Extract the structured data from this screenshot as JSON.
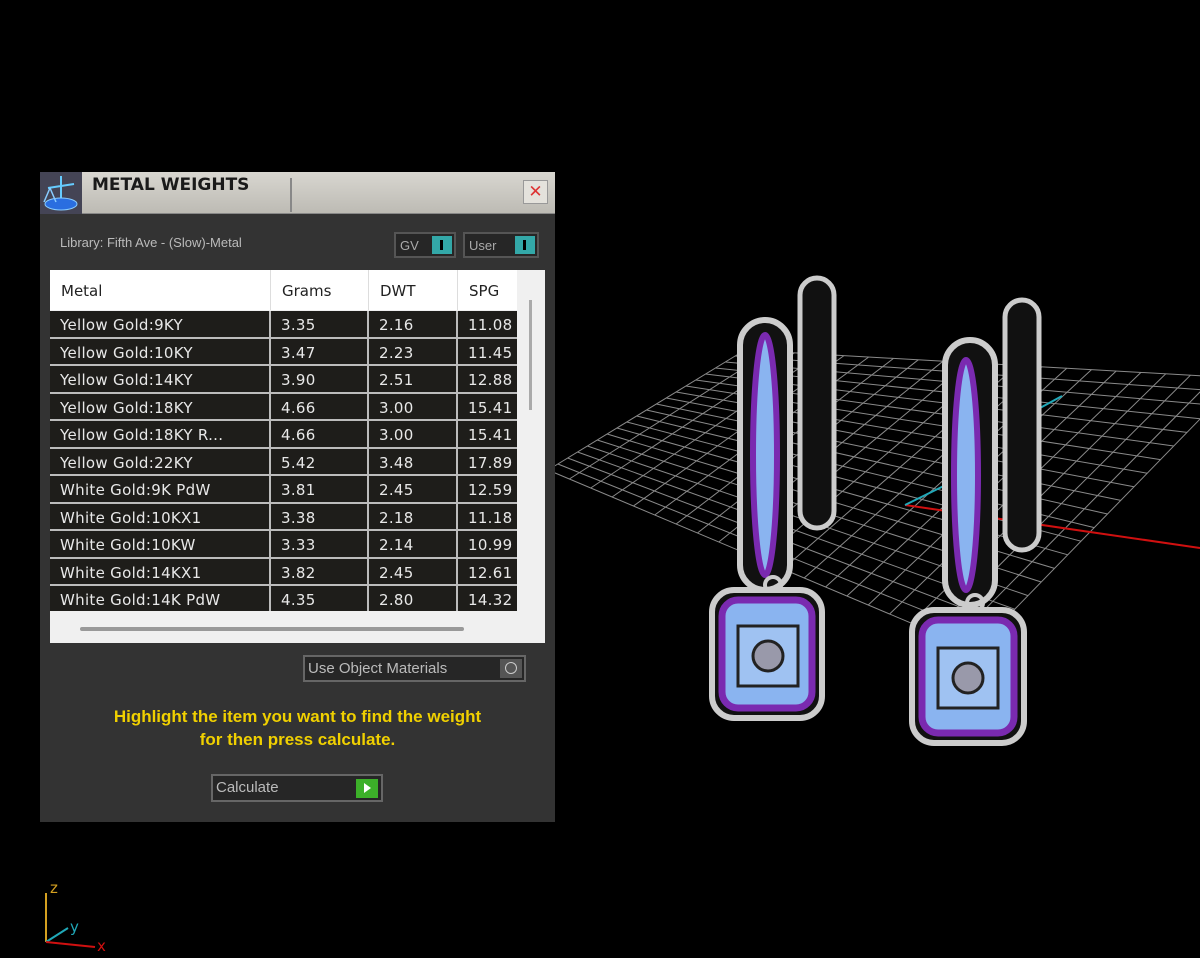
{
  "window": {
    "title": "METAL WEIGHTS",
    "close_icon": "close-icon",
    "app_icon": "scale-icon"
  },
  "library": {
    "label": "Library: Fifth Ave - (Slow)-Metal"
  },
  "toggles": {
    "gv": "GV",
    "user": "User"
  },
  "table": {
    "columns": [
      "Metal",
      "Grams",
      "DWT",
      "SPG"
    ],
    "rows": [
      [
        "Yellow Gold:9KY",
        "3.35",
        "2.16",
        "11.08"
      ],
      [
        "Yellow Gold:10KY",
        "3.47",
        "2.23",
        "11.45"
      ],
      [
        "Yellow Gold:14KY",
        "3.90",
        "2.51",
        "12.88"
      ],
      [
        "Yellow Gold:18KY",
        "4.66",
        "3.00",
        "15.41"
      ],
      [
        "Yellow Gold:18KY R...",
        "4.66",
        "3.00",
        "15.41"
      ],
      [
        "Yellow Gold:22KY",
        "5.42",
        "3.48",
        "17.89"
      ],
      [
        "White Gold:9K PdW",
        "3.81",
        "2.45",
        "12.59"
      ],
      [
        "White Gold:10KX1",
        "3.38",
        "2.18",
        "11.18"
      ],
      [
        "White Gold:10KW",
        "3.33",
        "2.14",
        "10.99"
      ],
      [
        "White Gold:14KX1",
        "3.82",
        "2.45",
        "12.61"
      ],
      [
        "White Gold:14K PdW",
        "4.35",
        "2.80",
        "14.32"
      ]
    ]
  },
  "use_object_materials": {
    "label": "Use Object Materials"
  },
  "instructions": {
    "line1": "Highlight the item you want to find the weight",
    "line2": "for then press calculate."
  },
  "calculate": {
    "label": "Calculate"
  },
  "axes": {
    "z": "z",
    "y": "y",
    "x": "x"
  },
  "colors": {
    "accent": "#33a8a8",
    "instruction": "#f0d000",
    "go": "#3cb029"
  }
}
